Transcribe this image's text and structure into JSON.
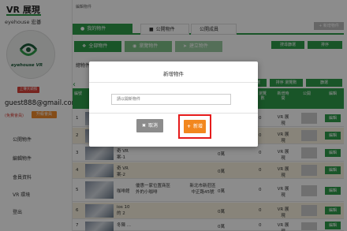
{
  "app": {
    "title": "VR 展現",
    "subtitle": "eyehouse 宏碁",
    "logo_text": "eyehouse VR"
  },
  "sidebar": {
    "upload_label": "上傳大頭照",
    "email": "guest888@gmail.com",
    "member_status": "(免費會員)",
    "member_upgrade": "升級會員",
    "items": [
      {
        "label": "公開物件"
      },
      {
        "label": "編輯物件"
      },
      {
        "label": "會員資料"
      },
      {
        "label": "VR 環境"
      },
      {
        "label": "登出"
      }
    ]
  },
  "main": {
    "breadcrumb": "編輯物件",
    "tabs": [
      {
        "label": "我的物件"
      },
      {
        "label": "公開物件"
      },
      {
        "label": "公開成員"
      }
    ],
    "new_button": "+ 新增物件",
    "subtabs": [
      {
        "label": "全部物件"
      },
      {
        "label": "瀏覽物件"
      },
      {
        "label": "建立物件"
      }
    ],
    "search_button": "搜尋篩選",
    "sort_button": "排序",
    "list_label": "總物件",
    "filter_button_a": "篩選",
    "filter_button_b": "排序 瀏覽數",
    "filter_button_c": "篩選",
    "columns": [
      "編號",
      "瀏覽數",
      "新增時間",
      "公開",
      "編輯"
    ],
    "rows": [
      {
        "no": "1",
        "name": "",
        "count1": "",
        "count2": "0",
        "time": "VR 展現",
        "action": "編輯"
      },
      {
        "no": "2",
        "name": "",
        "count1": "",
        "count2": "0",
        "time": "VR 展現",
        "action": "編輯"
      },
      {
        "no": "3",
        "name": "奇 VR 案-1",
        "count1": "0萬",
        "count2": "0",
        "time": "VR 展現",
        "action": "編輯"
      },
      {
        "no": "4",
        "name": "奇 VR 案-2",
        "count1": "0萬",
        "count2": "0",
        "time": "VR 展現",
        "action": "編輯"
      },
      {
        "no": "5",
        "name": "咖啡館",
        "count1": "0萬",
        "count2": "0",
        "time": "VR 展現",
        "action": "編輯"
      },
      {
        "no": "6",
        "name": "ios 10 的 2",
        "count1": "0萬",
        "count2": "0",
        "time": "VR 展現",
        "action": "編輯"
      },
      {
        "no": "7",
        "name": "冬陳 ...",
        "count1": "0萬",
        "count2": "0",
        "time": "VR 展現",
        "action": "編輯"
      }
    ],
    "row5_desc": "優惠一家位置商區外的小咖啡",
    "row5_addr": "新北市新莊區中正路45號"
  },
  "modal": {
    "title": "新增物件",
    "input_placeholder": "請以開新物件",
    "cancel_label": "取消",
    "add_label": "新增"
  },
  "colors": {
    "accent": "#2e9b4a",
    "danger": "#e51b1b",
    "orange": "#f2871e"
  }
}
